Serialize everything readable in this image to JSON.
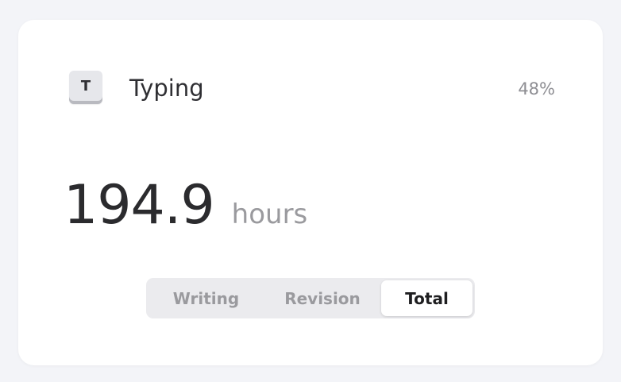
{
  "category": {
    "icon_letter": "T",
    "icon_name": "keyboard-key-icon",
    "label": "Typing",
    "percent": "48%"
  },
  "metric": {
    "value": "194.9",
    "unit": "hours"
  },
  "segments": {
    "options": [
      "Writing",
      "Revision",
      "Total"
    ],
    "selected": "Total"
  },
  "colors": {
    "background": "#f3f4f8",
    "card": "#ffffff",
    "primary_text": "#2b2b2e",
    "secondary_text": "#8e8e93"
  }
}
